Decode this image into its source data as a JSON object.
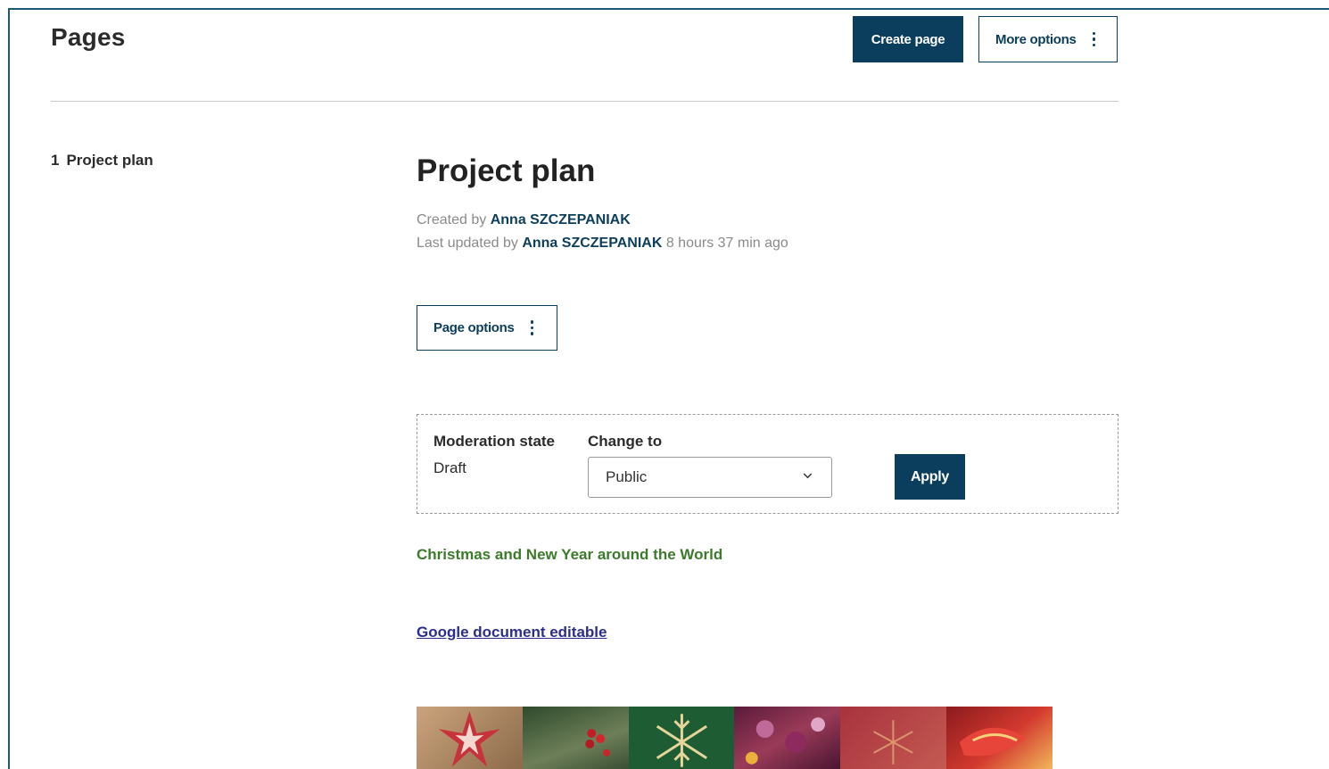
{
  "header": {
    "title": "Pages",
    "create_page_label": "Create page",
    "more_options_label": "More options"
  },
  "sidebar": {
    "items": [
      {
        "number": "1",
        "label": "Project plan"
      }
    ]
  },
  "page": {
    "title": "Project plan",
    "created_prefix": "Created by",
    "created_by": "Anna SZCZEPANIAK",
    "updated_prefix": "Last updated by",
    "updated_by": "Anna SZCZEPANIAK",
    "updated_ago": "8 hours 37 min ago",
    "page_options_label": "Page options"
  },
  "moderation": {
    "state_label": "Moderation state",
    "state_value": "Draft",
    "change_to_label": "Change to",
    "change_to_selected": "Public",
    "apply_label": "Apply"
  },
  "content": {
    "headline": "Christmas and New Year around the World",
    "link_text": "Google document editable"
  },
  "colors": {
    "accent": "#0b3e5c",
    "frame_border": "#1b5a73",
    "headline_green": "#3c7a2c",
    "link": "#2b2e8f"
  },
  "icons": {
    "more_options": "kebab-icon",
    "page_options": "kebab-icon",
    "select": "chevron-down-icon"
  }
}
